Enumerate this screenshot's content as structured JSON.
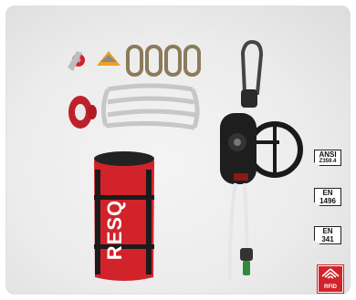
{
  "product": {
    "bag_brand": "RESQ",
    "colors": {
      "bag_red": "#d2232a",
      "device_black": "#1e1e1e",
      "rope_white": "#e8e8e8",
      "rfid_red": "#d2232a"
    }
  },
  "badges": [
    {
      "line1": "ANSI",
      "line2": "Z359.4"
    },
    {
      "line1": "EN",
      "line2": "1496"
    },
    {
      "line1": "EN",
      "line2": "341"
    }
  ],
  "rfid": {
    "label": "RFID",
    "icon": "rfid-house-icon"
  }
}
